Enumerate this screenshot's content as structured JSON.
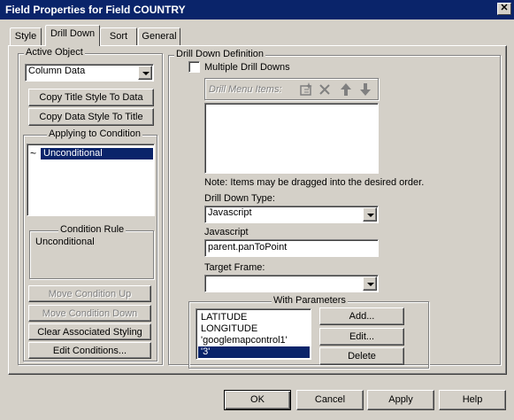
{
  "window": {
    "title": "Field Properties for Field COUNTRY",
    "close_glyph": "✕"
  },
  "tabs": [
    {
      "label": "Style"
    },
    {
      "label": "Drill Down"
    },
    {
      "label": "Sort"
    },
    {
      "label": "General"
    }
  ],
  "active_object": {
    "group_label": "Active Object",
    "select_value": "Column Data",
    "copy_title_btn": "Copy Title Style To Data",
    "copy_data_btn": "Copy Data Style To Title"
  },
  "applying": {
    "group_label": "Applying to Condition",
    "items": [
      {
        "label": "Unconditional",
        "selected": true
      }
    ],
    "condition_rule_label": "Condition Rule",
    "condition_rule_value": "Unconditional",
    "move_up_btn": "Move Condition Up",
    "move_down_btn": "Move Condition Down",
    "clear_btn": "Clear Associated Styling",
    "edit_btn": "Edit Conditions..."
  },
  "drill": {
    "group_label": "Drill Down Definition",
    "multiple_label": "Multiple Drill Downs",
    "multiple_checked": false,
    "menu_items_label": "Drill Menu Items:",
    "note": "Note:  Items may be dragged into the desired order.",
    "type_label": "Drill Down Type:",
    "type_value": "Javascript",
    "js_label": "Javascript",
    "js_value": "parent.panToPoint",
    "target_label": "Target Frame:",
    "target_value": ""
  },
  "params": {
    "group_label": "With Parameters",
    "items": [
      "LATITUDE",
      "LONGITUDE",
      "'googlemapcontrol1'",
      "'3'"
    ],
    "selected_index": 3,
    "add_btn": "Add...",
    "edit_btn": "Edit...",
    "delete_btn": "Delete"
  },
  "footer": {
    "ok": "OK",
    "cancel": "Cancel",
    "apply": "Apply",
    "help": "Help"
  },
  "colors": {
    "title_bg": "#0a246a",
    "face": "#d4d0c8",
    "selection": "#0a246a"
  }
}
